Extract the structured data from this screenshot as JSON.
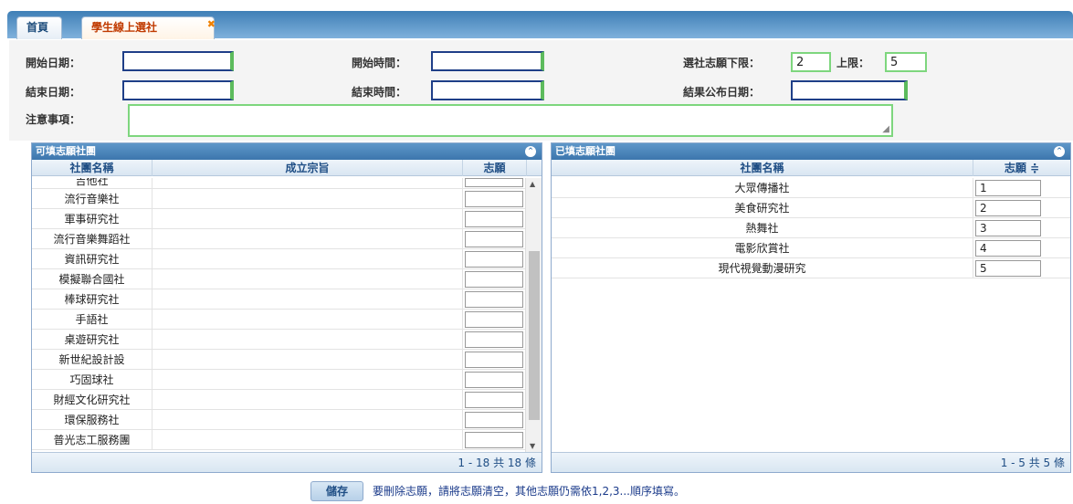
{
  "tabs": {
    "home": "首頁",
    "current": "學生線上選社",
    "close": "✖"
  },
  "form": {
    "start_date_label": "開始日期：",
    "start_time_label": "開始時間：",
    "min_choice_label": "選社志願下限：",
    "min_choice_value": "2",
    "max_label": "上限：",
    "max_value": "5",
    "end_date_label": "結束日期：",
    "end_time_label": "結束時間：",
    "result_date_label": "結果公布日期：",
    "notes_label": "注意事項："
  },
  "available": {
    "title": "可填志願社團",
    "headers": [
      "社團名稱",
      "成立宗旨",
      "志願"
    ],
    "rows": [
      "吉他社",
      "流行音樂社",
      "軍事研究社",
      "流行音樂舞蹈社",
      "資訊研究社",
      "模擬聯合國社",
      "棒球研究社",
      "手語社",
      "桌遊研究社",
      "新世紀設計設",
      "巧固球社",
      "財經文化研究社",
      "環保服務社",
      "普光志工服務團"
    ],
    "pager": "1 - 18 共 18 條"
  },
  "selected": {
    "title": "已填志願社團",
    "headers": [
      "社團名稱",
      "志願 ≑"
    ],
    "rows": [
      {
        "name": "大眾傳播社",
        "rank": "1"
      },
      {
        "name": "美食研究社",
        "rank": "2"
      },
      {
        "name": "熱舞社",
        "rank": "3"
      },
      {
        "name": "電影欣賞社",
        "rank": "4"
      },
      {
        "name": "現代視覺動漫研究",
        "rank": "5"
      }
    ],
    "pager": "1 - 5 共 5 條"
  },
  "footer": {
    "save": "儲存",
    "note": "要刪除志願，請將志願清空，其他志願仍需依1,2,3...順序填寫。"
  },
  "colors": {
    "header": "#3c76ad",
    "accent_green": "#5dbb5d",
    "input_blue": "#1f3f88"
  }
}
